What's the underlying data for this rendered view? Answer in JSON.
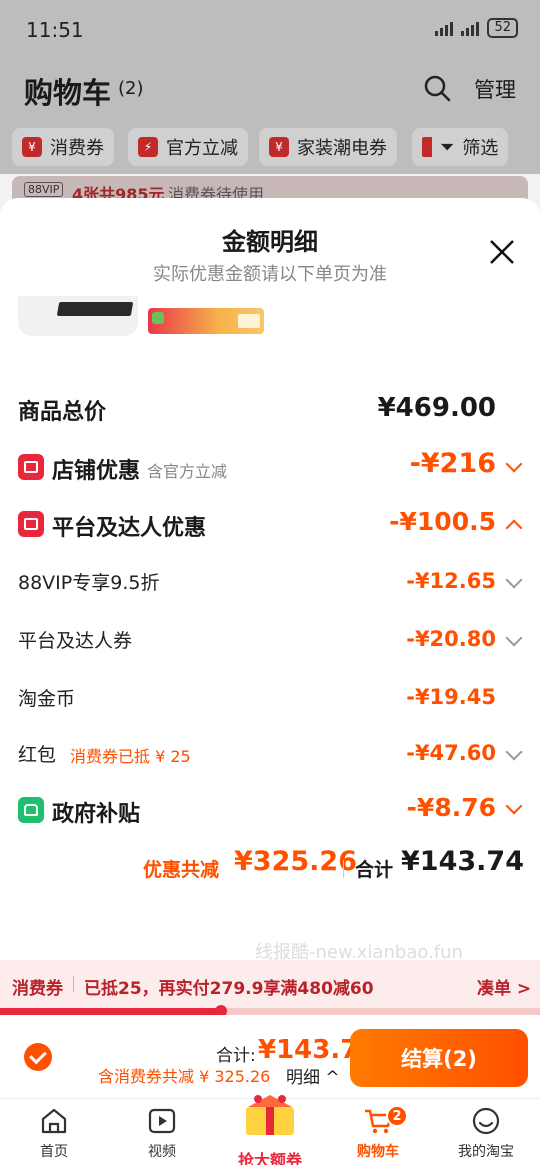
{
  "status_bar": {
    "time": "11:51",
    "battery": "52"
  },
  "header": {
    "title": "购物车",
    "count": "(2)",
    "manage": "管理"
  },
  "filters": [
    {
      "label": "消费券"
    },
    {
      "label": "官方立减"
    },
    {
      "label": "家装潮电券"
    },
    {
      "label": "筛选"
    }
  ],
  "vip_strip": {
    "tag": "88VIP",
    "highlight": "4张共985元",
    "text": "消费券待使用"
  },
  "sheet": {
    "title": "金额明细",
    "subtitle": "实际优惠金额请以下单页为准",
    "rows": {
      "total": {
        "label": "商品总价",
        "amount": "¥469.00"
      },
      "store": {
        "label": "店铺优惠",
        "note": "含官方立减",
        "amount": "-¥216"
      },
      "platform": {
        "label": "平台及达人优惠",
        "amount": "-¥100.5"
      },
      "vip": {
        "label": "88VIP专享9.5折",
        "amount": "-¥12.65"
      },
      "coupon": {
        "label": "平台及达人券",
        "amount": "-¥20.80"
      },
      "coin": {
        "label": "淘金币",
        "amount": "-¥19.45"
      },
      "redpack": {
        "label": "红包",
        "note": "消费券已抵 ¥ 25",
        "amount": "-¥47.60"
      },
      "gov": {
        "label": "政府补贴",
        "amount": "-¥8.76"
      }
    },
    "summary": {
      "discount_label": "优惠共减",
      "discount_amount": "¥325.26",
      "total_label": "合计",
      "total_amount": "¥143.74"
    }
  },
  "watermark": "线报酷-new.xianbao.fun",
  "coupon_bar": {
    "label": "消费券",
    "text": "已抵25，再实付279.9享满480减60",
    "action": "凑单 >",
    "progress": 0.41
  },
  "checkout": {
    "total_label": "合计:",
    "total_amount": "¥143.74",
    "saving_text": "含消费券共减 ¥ 325.26",
    "detail_label": "明细 ^",
    "button_label": "结算(2)"
  },
  "tab_bar": {
    "items": [
      {
        "label": "首页",
        "icon": "home-icon"
      },
      {
        "label": "视频",
        "icon": "video-icon"
      },
      {
        "label": "抢大额券",
        "icon": "gift-icon"
      },
      {
        "label": "购物车",
        "icon": "cart-icon",
        "badge": "2"
      },
      {
        "label": "我的淘宝",
        "icon": "profile-icon"
      }
    ]
  },
  "colors": {
    "accent": "#ff5000",
    "red": "#e8273a",
    "green": "#1fbf6f"
  }
}
